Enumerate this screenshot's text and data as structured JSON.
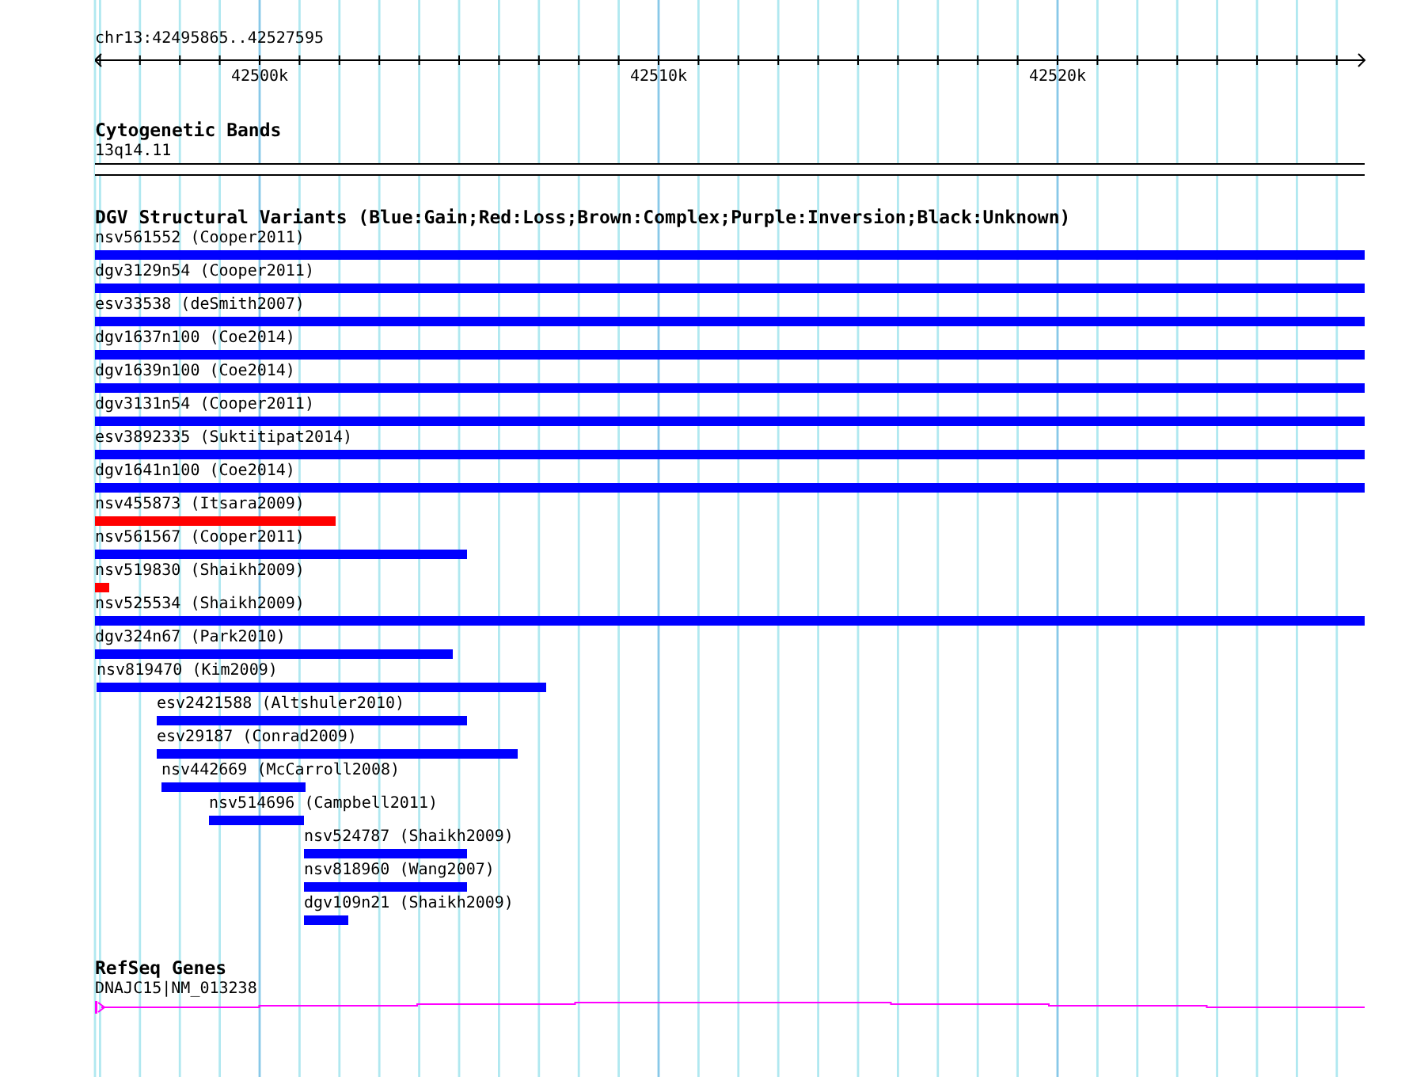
{
  "ruler": {
    "location": "chr13:42495865..42527595",
    "tick_labels": [
      "42500k",
      "42510k",
      "42520k"
    ]
  },
  "tracks": [
    {
      "kind": "bands",
      "title": "Cytogenetic Bands",
      "features": [
        {
          "label": "13q14.11"
        }
      ]
    },
    {
      "kind": "variants",
      "title": "DGV Structural Variants (Blue:Gain;Red:Loss;Brown:Complex;Purple:Inversion;Black:Unknown)",
      "features": [
        {
          "label": "nsv561552 (Cooper2011)",
          "color": "#0000ff"
        },
        {
          "label": "dgv3129n54 (Cooper2011)",
          "color": "#0000ff"
        },
        {
          "label": "esv33538 (deSmith2007)",
          "color": "#0000ff"
        },
        {
          "label": "dgv1637n100 (Coe2014)",
          "color": "#0000ff"
        },
        {
          "label": "dgv1639n100 (Coe2014)",
          "color": "#0000ff"
        },
        {
          "label": "dgv3131n54 (Cooper2011)",
          "color": "#0000ff"
        },
        {
          "label": "esv3892335 (Suktitipat2014)",
          "color": "#0000ff"
        },
        {
          "label": "dgv1641n100 (Coe2014)",
          "color": "#0000ff"
        },
        {
          "label": "nsv455873 (Itsara2009)",
          "color": "#ff0000"
        },
        {
          "label": "nsv561567 (Cooper2011)",
          "color": "#0000ff"
        },
        {
          "label": "nsv519830 (Shaikh2009)",
          "color": "#ff0000"
        },
        {
          "label": "nsv525534 (Shaikh2009)",
          "color": "#0000ff"
        },
        {
          "label": "dgv324n67 (Park2010)",
          "color": "#0000ff"
        },
        {
          "label": "nsv819470 (Kim2009)",
          "color": "#0000ff"
        },
        {
          "label": "esv2421588 (Altshuler2010)",
          "color": "#0000ff"
        },
        {
          "label": "esv29187 (Conrad2009)",
          "color": "#0000ff"
        },
        {
          "label": "nsv442669 (McCarroll2008)",
          "color": "#0000ff"
        },
        {
          "label": "nsv514696 (Campbell2011)",
          "color": "#0000ff"
        },
        {
          "label": "nsv524787 (Shaikh2009)",
          "color": "#0000ff"
        },
        {
          "label": "nsv818960 (Wang2007)",
          "color": "#0000ff"
        },
        {
          "label": "dgv109n21 (Shaikh2009)",
          "color": "#0000ff"
        }
      ]
    },
    {
      "kind": "genes",
      "title": "RefSeq Genes",
      "features": [
        {
          "label": "DNAJC15|NM_013238"
        }
      ]
    }
  ]
}
